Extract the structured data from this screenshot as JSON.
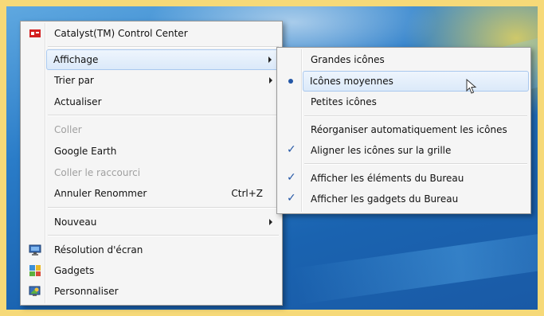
{
  "main_menu": {
    "catalyst": "Catalyst(TM) Control Center",
    "affichage": "Affichage",
    "trier_par": "Trier par",
    "actualiser": "Actualiser",
    "coller": "Coller",
    "google_earth": "Google Earth",
    "coller_raccourci": "Coller le raccourci",
    "annuler": "Annuler Renommer",
    "annuler_shortcut": "Ctrl+Z",
    "nouveau": "Nouveau",
    "resolution": "Résolution d'écran",
    "gadgets": "Gadgets",
    "personnaliser": "Personnaliser"
  },
  "sub_menu": {
    "grandes": "Grandes icônes",
    "moyennes": "Icônes moyennes",
    "petites": "Petites icônes",
    "reorganiser": "Réorganiser automatiquement les icônes",
    "aligner": "Aligner les icônes sur la grille",
    "afficher_elements": "Afficher les éléments du Bureau",
    "afficher_gadgets": "Afficher les gadgets du Bureau"
  },
  "glyphs": {
    "check": "✓"
  },
  "colors": {
    "frame": "#f6d978",
    "highlight_border": "#a9c8ee",
    "check": "#2457a6",
    "catalyst_icon": "#d42020"
  }
}
